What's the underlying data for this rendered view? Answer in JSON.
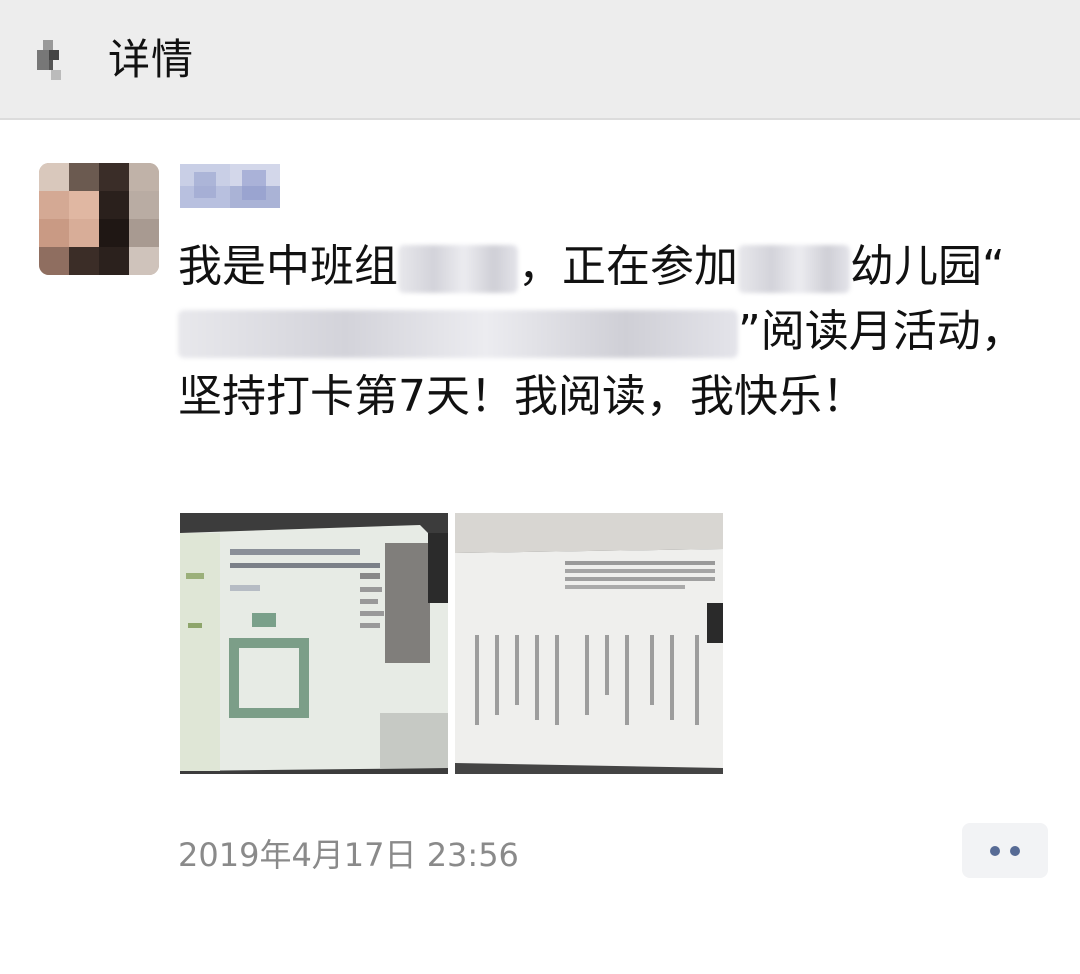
{
  "header": {
    "title": "详情",
    "back_icon": "chevron-left-icon"
  },
  "post": {
    "text_segments": [
      "我是中班组",
      "，正在参加",
      "幼儿园“",
      "”阅读月活动，坚持打卡第7天！我阅读，我快乐！"
    ],
    "photos": [
      {
        "alt": "book-page-photo-1"
      },
      {
        "alt": "book-page-photo-2"
      }
    ],
    "timestamp": "2019年4月17日 23:56",
    "more_icon": "more-dots-icon"
  },
  "colors": {
    "header_bg": "#ededed",
    "timestamp": "#8a8a8a",
    "more_dots": "#576b95"
  }
}
